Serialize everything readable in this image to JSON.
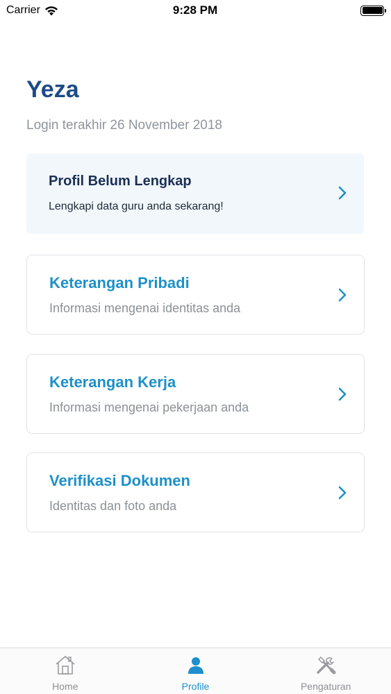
{
  "status_bar": {
    "carrier": "Carrier",
    "time": "9:28 PM",
    "wifi_icon": "wifi-icon",
    "battery_icon": "battery-icon"
  },
  "profile": {
    "name": "Yeza",
    "last_login": "Login terakhir 26 November 2018"
  },
  "alert": {
    "title": "Profil Belum Lengkap",
    "subtitle": "Lengkapi data guru anda sekarang!"
  },
  "menu": [
    {
      "title": "Keterangan Pribadi",
      "subtitle": "Informasi mengenai identitas anda"
    },
    {
      "title": "Keterangan Kerja",
      "subtitle": "Informasi mengenai pekerjaan anda"
    },
    {
      "title": "Verifikasi Dokumen",
      "subtitle": "Identitas dan foto anda"
    }
  ],
  "tabs": [
    {
      "label": "Home",
      "icon": "house-icon",
      "active": false
    },
    {
      "label": "Profile",
      "icon": "person-icon",
      "active": true
    },
    {
      "label": "Pengaturan",
      "icon": "tools-icon",
      "active": false
    }
  ],
  "colors": {
    "accent": "#1e90c8",
    "name": "#1d4b86",
    "alert_bg": "#f2f7fc",
    "inactive_tab": "#8e8e93"
  }
}
